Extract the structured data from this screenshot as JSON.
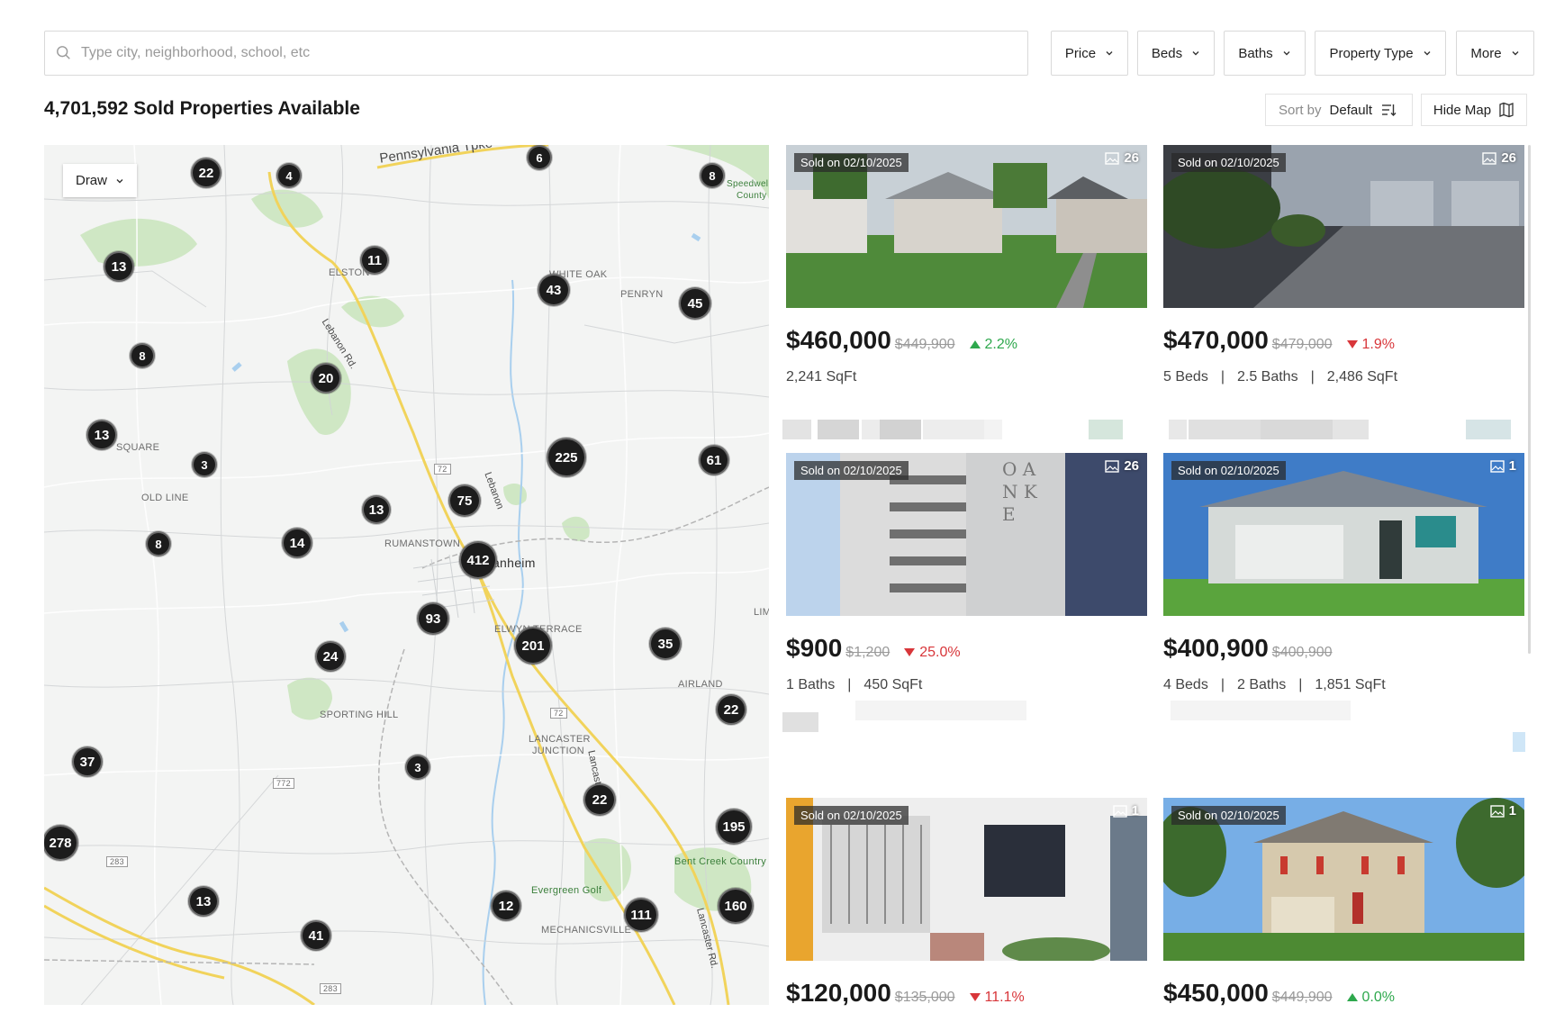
{
  "search": {
    "placeholder": "Type city, neighborhood, school, etc",
    "value": ""
  },
  "filters": [
    {
      "label": "Price"
    },
    {
      "label": "Beds"
    },
    {
      "label": "Baths"
    },
    {
      "label": "Property Type"
    },
    {
      "label": "More"
    }
  ],
  "header": {
    "title": "4,701,592 Sold Properties Available",
    "sort_label": "Sort by",
    "sort_value": "Default",
    "hide_map": "Hide Map"
  },
  "map": {
    "draw_label": "Draw",
    "clusters": [
      "22",
      "4",
      "6",
      "8",
      "13",
      "11",
      "43",
      "45",
      "8",
      "20",
      "13",
      "3",
      "225",
      "61",
      "75",
      "13",
      "8",
      "14",
      "412",
      "93",
      "201",
      "35",
      "24",
      "22",
      "37",
      "3",
      "22",
      "195",
      "278",
      "13",
      "12",
      "111",
      "160",
      "41"
    ],
    "place_labels": [
      "ELSTON",
      "WHITE OAK",
      "PENRYN",
      "SQUARE",
      "OLD LINE",
      "RUMANSTOWN",
      "Manheim",
      "ELWYN TERRACE",
      "SPORTING HILL",
      "LANCASTER",
      "JUNCTION",
      "AIRLAND",
      "LIM",
      "MECHANICSVILLE",
      "Evergreen Golf",
      "Bent Creek Country",
      "Speedwell",
      "County"
    ],
    "road_labels": [
      "Pennsylvania Tpke",
      "Lebanon Rd.",
      "Lancaster Rd.",
      "Lancaster Rd.",
      "Lebanon"
    ],
    "route_shields": [
      "72",
      "72",
      "772",
      "283",
      "283"
    ]
  },
  "listings": [
    {
      "sold": "Sold on 02/10/2025",
      "images": "26",
      "price": "$460,000",
      "old_price": "$449,900",
      "change": "2.2%",
      "direction": "up",
      "specs": [
        "2,241 SqFt"
      ]
    },
    {
      "sold": "Sold on 02/10/2025",
      "images": "26",
      "price": "$470,000",
      "old_price": "$479,000",
      "change": "1.9%",
      "direction": "down",
      "specs": [
        "5 Beds",
        "2.5 Baths",
        "2,486 SqFt"
      ]
    },
    {
      "sold": "Sold on 02/10/2025",
      "images": "26",
      "price": "$900",
      "old_price": "$1,200",
      "change": "25.0%",
      "direction": "down",
      "specs": [
        "1 Baths",
        "450 SqFt"
      ]
    },
    {
      "sold": "Sold on 02/10/2025",
      "images": "1",
      "price": "$400,900",
      "old_price": "$400,900",
      "change": "",
      "direction": "none",
      "specs": [
        "4 Beds",
        "2 Baths",
        "1,851 SqFt"
      ]
    },
    {
      "sold": "Sold on 02/10/2025",
      "images": "1",
      "price": "$120,000",
      "old_price": "$135,000",
      "change": "11.1%",
      "direction": "down",
      "specs": []
    },
    {
      "sold": "Sold on 02/10/2025",
      "images": "1",
      "price": "$450,000",
      "old_price": "$449,900",
      "change": "0.0%",
      "direction": "up",
      "specs": []
    }
  ],
  "colors": {
    "up": "#2ea84d",
    "down": "#d8363a",
    "cluster": "#1c1c1c",
    "map_bg": "#f3f4f3",
    "park": "#cfe7c4",
    "road_major": "#f5dd6b",
    "water": "#a9cfee"
  }
}
